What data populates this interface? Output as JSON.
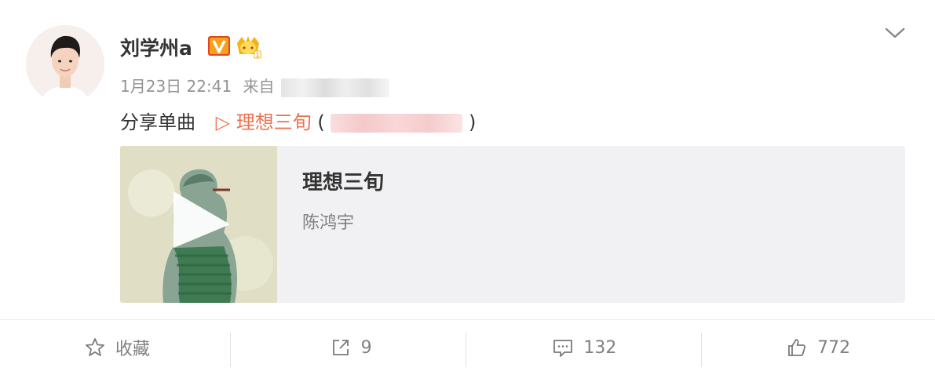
{
  "post": {
    "author": "刘学州a",
    "badges": [
      "verified-v-icon",
      "crown-member-icon"
    ],
    "timestamp": "1月23日 22:41",
    "source_prefix": "来自",
    "text": "分享单曲",
    "song_link": "▷ 理想三旬",
    "paren_open": "(",
    "paren_close": ")"
  },
  "music_card": {
    "title": "理想三旬",
    "artist": "陈鸿宇",
    "cover_icon": "play-icon"
  },
  "actions": [
    {
      "icon": "star-icon",
      "label": "收藏"
    },
    {
      "icon": "share-icon",
      "label": "9"
    },
    {
      "icon": "comment-icon",
      "label": "132"
    },
    {
      "icon": "thumbs-up-icon",
      "label": "772"
    }
  ],
  "colors": {
    "link": "#eb7350",
    "secondary_text": "#939393",
    "card_bg": "#f1f1f3",
    "verified_badge": "#f09a1a"
  }
}
